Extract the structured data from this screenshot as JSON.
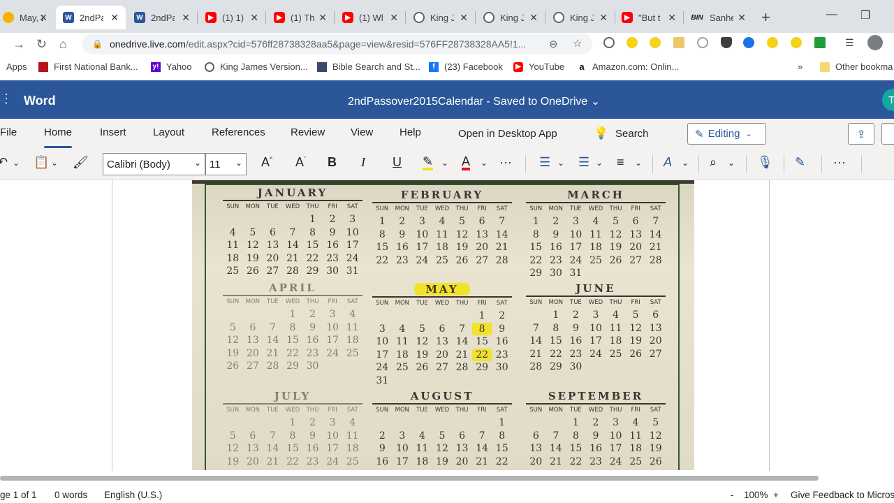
{
  "browser": {
    "tabs": [
      {
        "title": "May, 2",
        "icon": "partial-icon",
        "active": false
      },
      {
        "title": "2ndPa",
        "icon": "word-icon",
        "active": true
      },
      {
        "title": "2ndPa",
        "icon": "word-icon",
        "active": false
      },
      {
        "title": "(1) 1)",
        "icon": "youtube-icon",
        "active": false
      },
      {
        "title": "(1) Th",
        "icon": "youtube-icon",
        "active": false
      },
      {
        "title": "(1) Wl",
        "icon": "youtube-icon",
        "active": false
      },
      {
        "title": "King J",
        "icon": "globe-icon",
        "active": false
      },
      {
        "title": "King J",
        "icon": "globe-icon",
        "active": false
      },
      {
        "title": "King J",
        "icon": "globe-icon",
        "active": false
      },
      {
        "title": "\"But t",
        "icon": "youtube-icon",
        "active": false
      },
      {
        "title": "Sanhe",
        "icon": "bin-icon",
        "active": false
      }
    ],
    "url_host": "onedrive.live.com",
    "url_path": "/edit.aspx?cid=576ff28738328aa5&page=view&resid=576FF28738328AA5!1...",
    "bookmarks": [
      {
        "label": "Apps",
        "icon": "apps-grid-icon"
      },
      {
        "label": "First National Bank...",
        "icon": "bank-icon"
      },
      {
        "label": "Yahoo",
        "icon": "yahoo-icon"
      },
      {
        "label": "King James Version...",
        "icon": "globe-icon"
      },
      {
        "label": "Bible Search and St...",
        "icon": "bible-icon"
      },
      {
        "label": "(23) Facebook",
        "icon": "facebook-icon"
      },
      {
        "label": "YouTube",
        "icon": "youtube-icon"
      },
      {
        "label": "Amazon.com: Onlin...",
        "icon": "amazon-icon"
      },
      {
        "label": "Other bookma",
        "icon": "folder-icon"
      }
    ],
    "more_bookmarks": "»"
  },
  "word": {
    "app_name": "Word",
    "doc_title": "2ndPassover2015Calendar  -  Saved to OneDrive ⌄",
    "avatar_initial": "T",
    "ribbon_tabs": [
      "File",
      "Home",
      "Insert",
      "Layout",
      "References",
      "Review",
      "View",
      "Help"
    ],
    "open_desktop": "Open in Desktop App",
    "search_label": "Search",
    "editing_label": "Editing",
    "font_name": "Calibri (Body)",
    "font_size": "11",
    "toolbar_glyphs": {
      "bold": "B",
      "italic": "I",
      "underline": "U",
      "more": "···",
      "overflow": "···"
    }
  },
  "calendar": {
    "dow": [
      "SUN",
      "MON",
      "TUE",
      "WED",
      "THU",
      "FRI",
      "SAT"
    ],
    "months": [
      {
        "name": "JANUARY",
        "days": [
          "",
          "",
          "",
          "",
          1,
          2,
          3,
          4,
          5,
          6,
          7,
          8,
          9,
          10,
          11,
          12,
          13,
          14,
          15,
          16,
          17,
          18,
          19,
          20,
          21,
          22,
          23,
          24,
          25,
          26,
          27,
          28,
          29,
          30,
          31
        ]
      },
      {
        "name": "FEBRUARY",
        "days": [
          1,
          2,
          3,
          4,
          5,
          6,
          7,
          8,
          9,
          10,
          11,
          12,
          13,
          14,
          15,
          16,
          17,
          18,
          19,
          20,
          21,
          22,
          23,
          24,
          25,
          26,
          27,
          28
        ]
      },
      {
        "name": "MARCH",
        "days": [
          1,
          2,
          3,
          4,
          5,
          6,
          7,
          8,
          9,
          10,
          11,
          12,
          13,
          14,
          15,
          16,
          17,
          18,
          19,
          20,
          21,
          22,
          23,
          24,
          25,
          26,
          27,
          28,
          29,
          30,
          31
        ]
      },
      {
        "name": "APRIL",
        "days": [
          "",
          "",
          "",
          1,
          2,
          3,
          4,
          5,
          6,
          7,
          8,
          9,
          10,
          11,
          12,
          13,
          14,
          15,
          16,
          17,
          18,
          19,
          20,
          21,
          22,
          23,
          24,
          25,
          26,
          27,
          28,
          29,
          30
        ]
      },
      {
        "name": "MAY",
        "days": [
          "",
          "",
          "",
          "",
          "",
          1,
          2,
          3,
          4,
          5,
          6,
          7,
          8,
          9,
          10,
          11,
          12,
          13,
          14,
          15,
          16,
          17,
          18,
          19,
          20,
          21,
          22,
          23,
          24,
          25,
          26,
          27,
          28,
          29,
          30,
          31
        ]
      },
      {
        "name": "JUNE",
        "days": [
          "",
          1,
          2,
          3,
          4,
          5,
          6,
          7,
          8,
          9,
          10,
          11,
          12,
          13,
          14,
          15,
          16,
          17,
          18,
          19,
          20,
          21,
          22,
          23,
          24,
          25,
          26,
          27,
          28,
          29,
          30
        ]
      },
      {
        "name": "JULY",
        "days": [
          "",
          "",
          "",
          1,
          2,
          3,
          4,
          5,
          6,
          7,
          8,
          9,
          10,
          11,
          12,
          13,
          14,
          15,
          16,
          17,
          18,
          19,
          20,
          21,
          22,
          23,
          24,
          25
        ]
      },
      {
        "name": "AUGUST",
        "days": [
          "",
          "",
          "",
          "",
          "",
          "",
          1,
          2,
          3,
          4,
          5,
          6,
          7,
          8,
          9,
          10,
          11,
          12,
          13,
          14,
          15,
          16,
          17,
          18,
          19,
          20,
          21,
          22
        ]
      },
      {
        "name": "SEPTEMBER",
        "days": [
          "",
          "",
          1,
          2,
          3,
          4,
          5,
          6,
          7,
          8,
          9,
          10,
          11,
          12,
          13,
          14,
          15,
          16,
          17,
          18,
          19,
          20,
          21,
          22,
          23,
          24,
          25,
          26
        ]
      }
    ],
    "highlighted": {
      "month": "MAY",
      "days": [
        8,
        22
      ]
    },
    "highlight_color": "#f2e22a"
  },
  "status": {
    "page": "ge 1 of 1",
    "words": "0 words",
    "language": "English (U.S.)",
    "zoom_minus": "-",
    "zoom": "100%",
    "zoom_plus": "+",
    "feedback": "Give Feedback to Micros"
  },
  "colors": {
    "word_blue": "#2b579a",
    "ribbon_bg": "#f3f2f1",
    "tab_strip": "#dee1e6"
  }
}
